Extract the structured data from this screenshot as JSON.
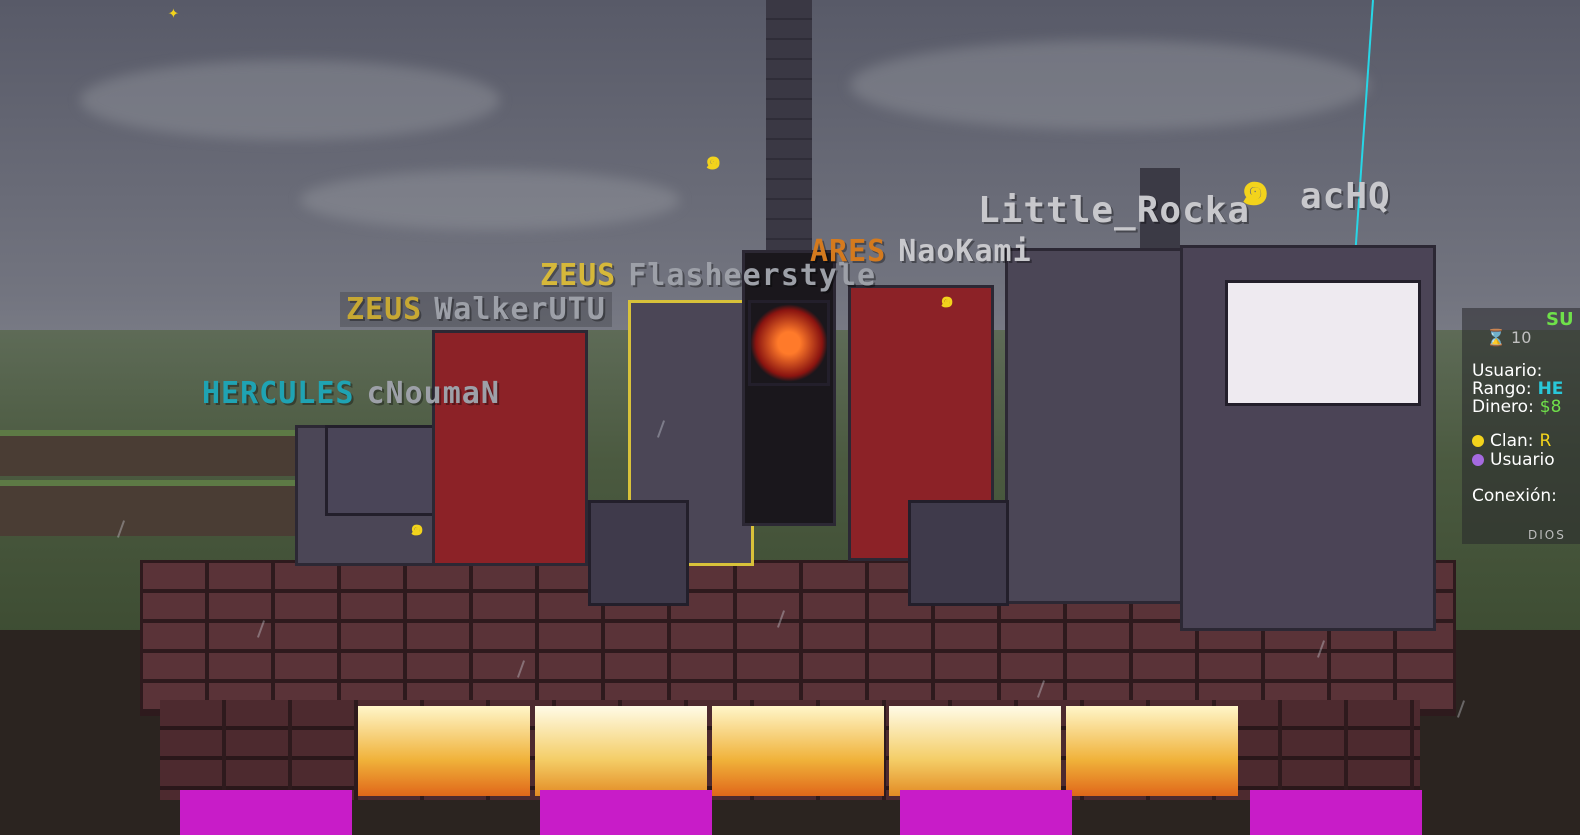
{
  "nametags": [
    {
      "rank": "ZEUS",
      "player": "Flasheerstyle",
      "rank_color": "#d6b83a"
    },
    {
      "rank": "ZEUS",
      "player": "WalkerUTU",
      "rank_color": "#c7a833"
    },
    {
      "rank": "HERCULES",
      "player": "cNoumaN",
      "rank_color": "#1fa3b3"
    },
    {
      "rank": "ARES",
      "player": "NaoKami",
      "rank_color": "#d47a1e"
    },
    {
      "rank": "",
      "player": "Little_Rocka",
      "rank_color": "#cfcfd3"
    },
    {
      "rank": "",
      "player": "acHQ",
      "rank_color": "#cfcfd3"
    }
  ],
  "scoreboard": {
    "title": "SU",
    "timer": "⌛ 10",
    "lines": {
      "usuario_label": "Usuario:",
      "rango_label": "Rango:",
      "rango_value": "HE",
      "dinero_label": "Dinero:",
      "dinero_value": "$8",
      "clan_label": "Clan:",
      "clan_value": "R",
      "usuario2_label": "Usuario",
      "conexion_label": "Conexión:"
    },
    "footer": "DIOS",
    "colors": {
      "title": "#6fe04a",
      "rango": "#29c7d8",
      "dinero": "#6fe04a",
      "clan": "#f2d31c"
    }
  }
}
